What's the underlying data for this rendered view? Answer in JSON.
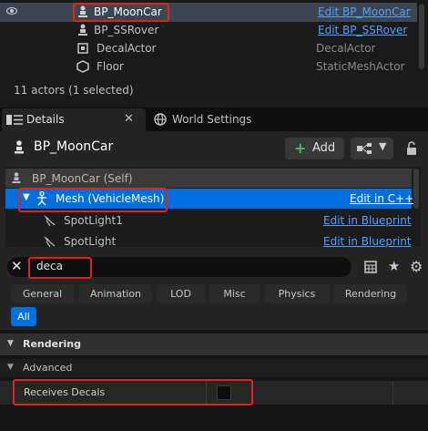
{
  "outliner": {
    "rows": [
      {
        "name": "BP_MoonCar",
        "type": "Edit BP_MoonCar",
        "type_is_link": true,
        "selected": true
      },
      {
        "name": "BP_SSRover",
        "type": "Edit BP_SSRover",
        "type_is_link": true,
        "selected": false
      },
      {
        "name": "DecalActor",
        "type": "DecalActor",
        "type_is_link": false,
        "selected": false
      },
      {
        "name": "Floor",
        "type": "StaticMeshActor",
        "type_is_link": false,
        "selected": false
      }
    ],
    "status": "11 actors (1 selected)"
  },
  "tabs": {
    "details": "Details",
    "world_settings": "World Settings"
  },
  "details": {
    "actor_name": "BP_MoonCar",
    "add_label": "Add",
    "components": [
      {
        "label": "BP_MoonCar (Self)",
        "link": ""
      },
      {
        "label": "Mesh (VehicleMesh)",
        "link": "Edit in C++"
      },
      {
        "label": "SpotLight1",
        "link": "Edit in Blueprint"
      },
      {
        "label": "SpotLight",
        "link": "Edit in Blueprint"
      }
    ],
    "search_value": "deca",
    "categories": [
      "General",
      "Animation",
      "LOD",
      "Misc",
      "Physics",
      "Rendering",
      "All"
    ],
    "section": "Rendering",
    "subsection": "Advanced",
    "property_label": "Receives Decals",
    "receives_decals": false
  },
  "colors": {
    "accent": "#0070e0",
    "link": "#4ea1ff",
    "highlight": "#e0231c"
  }
}
